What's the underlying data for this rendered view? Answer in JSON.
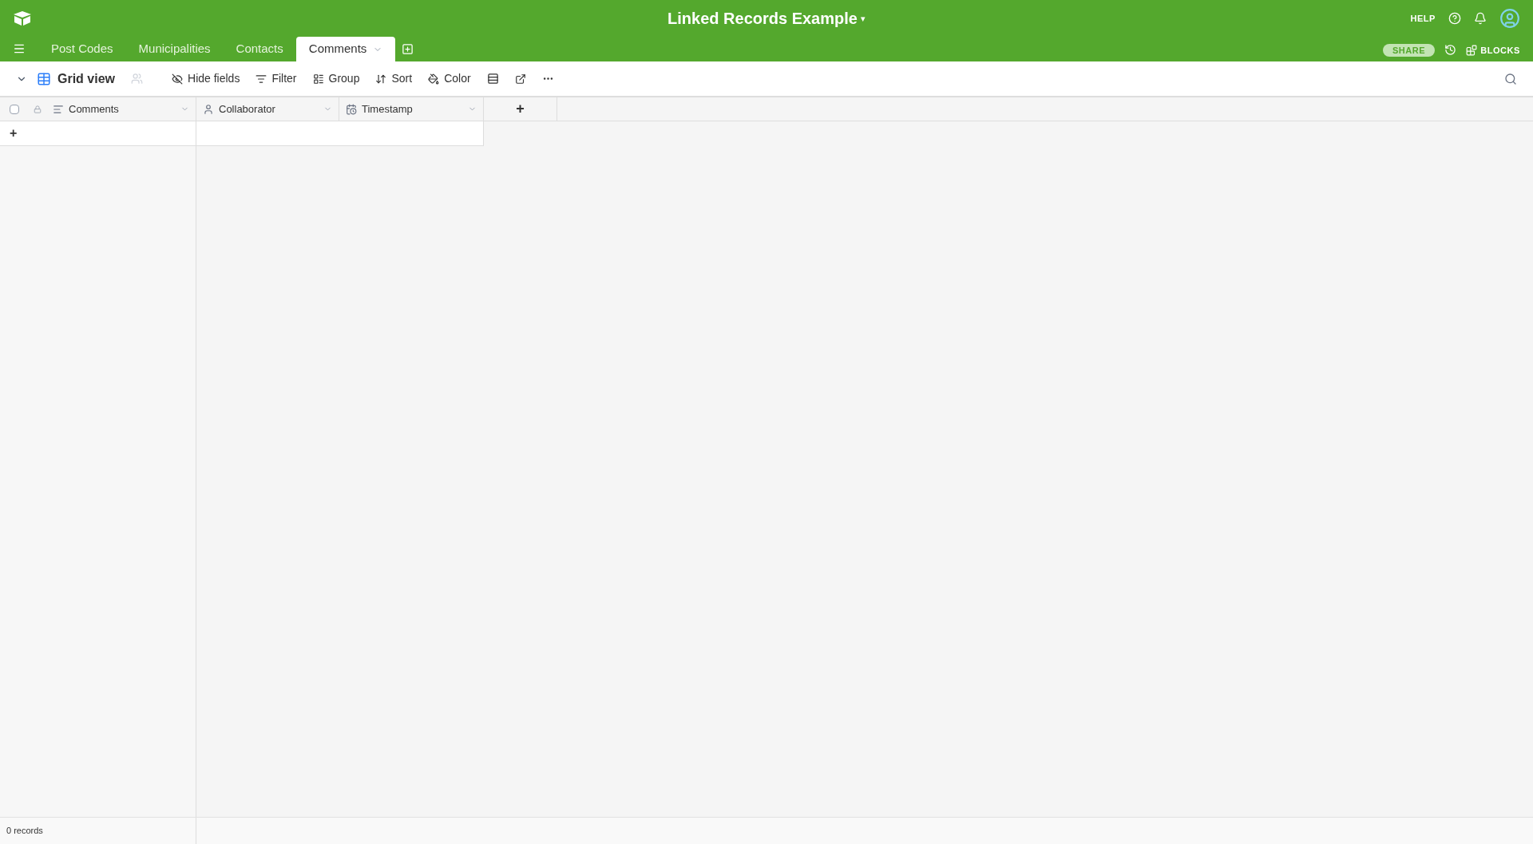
{
  "base": {
    "title": "Linked Records Example",
    "caret": "▾"
  },
  "header_links": {
    "help": "HELP",
    "share": "SHARE",
    "blocks": "BLOCKS"
  },
  "tabs": [
    {
      "label": "Post Codes",
      "selected": false
    },
    {
      "label": "Municipalities",
      "selected": false
    },
    {
      "label": "Contacts",
      "selected": false
    },
    {
      "label": "Comments",
      "selected": true
    }
  ],
  "view": {
    "name": "Grid view"
  },
  "toolbar": [
    {
      "kind": "hide",
      "label": "Hide fields"
    },
    {
      "kind": "filter",
      "label": "Filter"
    },
    {
      "kind": "group",
      "label": "Group"
    },
    {
      "kind": "sort",
      "label": "Sort"
    },
    {
      "kind": "color",
      "label": "Color"
    }
  ],
  "columns": [
    {
      "kind": "text",
      "label": "Comments"
    },
    {
      "kind": "user",
      "label": "Collaborator"
    },
    {
      "kind": "date",
      "label": "Timestamp"
    }
  ],
  "select_all": {
    "checked": false
  },
  "add_column": "+",
  "add_row": "+",
  "status_bar": "0 records"
}
